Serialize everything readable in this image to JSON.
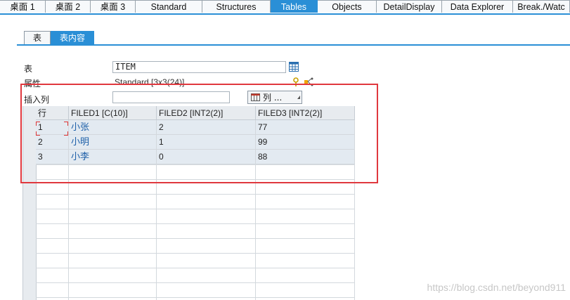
{
  "tabs": [
    {
      "label": "桌面 1",
      "active": false
    },
    {
      "label": "桌面 2",
      "active": false
    },
    {
      "label": "桌面 3",
      "active": false
    },
    {
      "label": "Standard",
      "active": false
    },
    {
      "label": "Structures",
      "active": false
    },
    {
      "label": "Tables",
      "active": true
    },
    {
      "label": "Objects",
      "active": false
    },
    {
      "label": "DetailDisplay",
      "active": false
    },
    {
      "label": "Data Explorer",
      "active": false
    },
    {
      "label": "Break./Watc",
      "active": false
    }
  ],
  "subtabs": {
    "table": "表",
    "content": "表内容"
  },
  "form": {
    "table_label": "表",
    "table_value": "ITEM",
    "attr_label": "属性",
    "attr_value": "Standard [3x3(24)]",
    "insert_label": "插入列",
    "insert_value": "",
    "columns_button": "列 ..."
  },
  "grid": {
    "headers": [
      "行",
      "FILED1 [C(10)]",
      "FILED2 [INT2(2)]",
      "FILED3 [INT2(2)]"
    ],
    "rows": [
      [
        "1",
        "小张",
        "2",
        "77"
      ],
      [
        "2",
        "小明",
        "1",
        "99"
      ],
      [
        "3",
        "小李",
        "0",
        "88"
      ]
    ]
  },
  "watermark": "https://blog.csdn.net/beyond911",
  "colors": {
    "accent": "#2a8fd6",
    "highlight": "#e0383e",
    "value_blue": "#1d5fa8"
  }
}
